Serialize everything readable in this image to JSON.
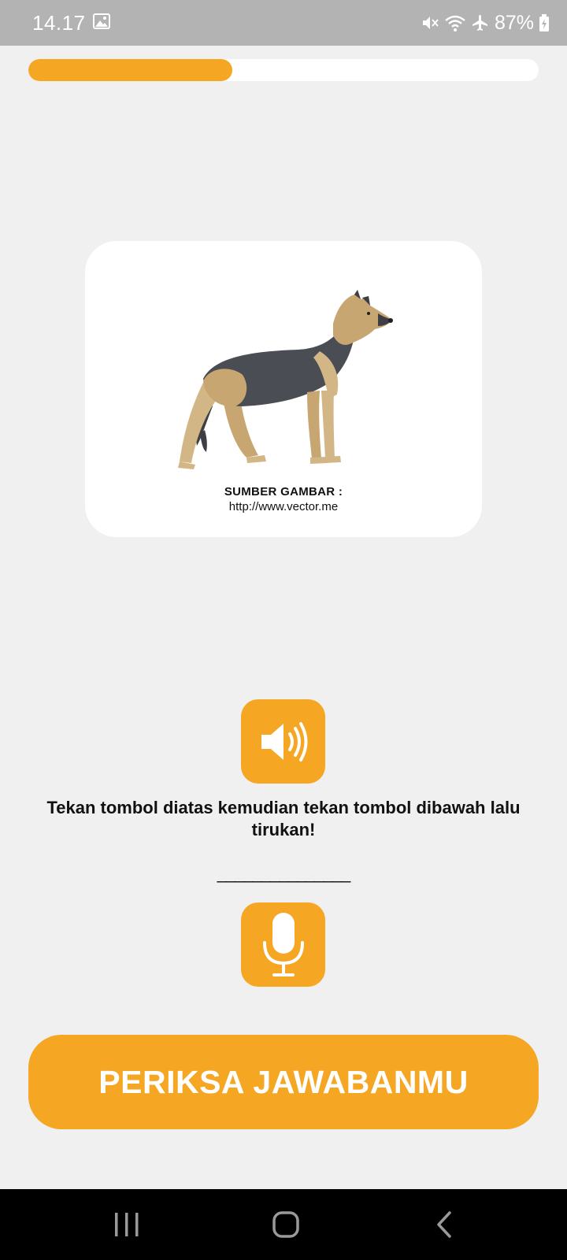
{
  "status_bar": {
    "time": "14.17",
    "battery_percent": "87%",
    "icons": [
      "gallery-icon",
      "mute-icon",
      "wifi-icon",
      "airplane-icon",
      "battery-charging-icon"
    ]
  },
  "progress": {
    "fraction": 0.4
  },
  "image_card": {
    "image": "german-shepherd-dog",
    "credit_title": "SUMBER GAMBAR :",
    "credit_url": "http://www.vector.me"
  },
  "speaker_button": {
    "icon": "speaker-icon"
  },
  "instruction_text": "Tekan tombol diatas kemudian tekan tombol dibawah lalu tirukan!",
  "answer_blank": "_______________",
  "mic_button": {
    "icon": "microphone-icon"
  },
  "check_button": {
    "label": "PERIKSA JAWABANMU"
  },
  "nav_bar": {
    "icons": [
      "recents-icon",
      "home-icon",
      "back-icon"
    ]
  },
  "colors": {
    "accent": "#f5a623",
    "background": "#f0f0f0",
    "status_bar": "#b3b3b3",
    "nav_bar": "#000000"
  }
}
